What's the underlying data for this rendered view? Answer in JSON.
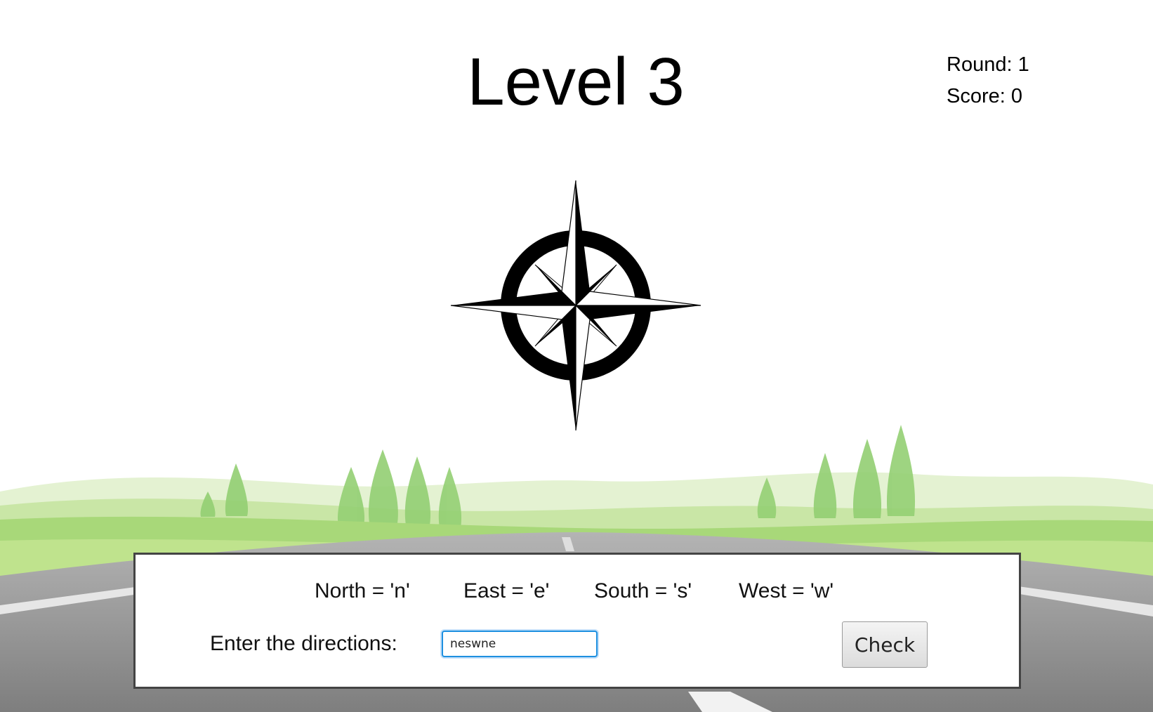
{
  "game": {
    "title": "Level 3",
    "round_text": "Round: 1",
    "score_text": "Score: 0",
    "round": 1,
    "score": 0
  },
  "compass": {
    "icon": "compass-rose-icon"
  },
  "legend": {
    "north": "North = 'n'",
    "east": "East = 'e'",
    "south": "South = 's'",
    "west": "West = 'w'"
  },
  "input": {
    "prompt": "Enter the directions:",
    "value": "neswne"
  },
  "actions": {
    "check_label": "Check"
  },
  "colors": {
    "input_focus": "#1e90e0",
    "grass_light": "#c8e6a0",
    "grass": "#9fd470",
    "trees": "#7cc464",
    "road": "#8a8a8a"
  }
}
